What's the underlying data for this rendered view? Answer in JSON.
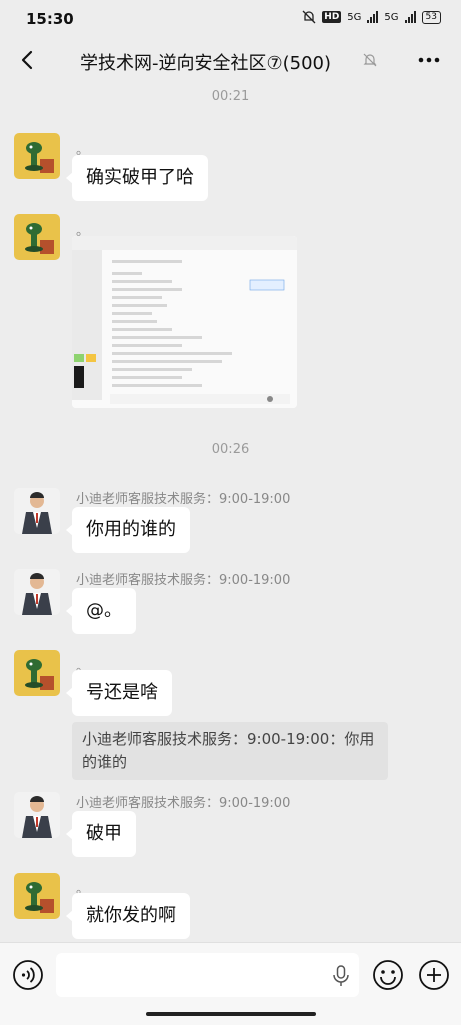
{
  "status_bar": {
    "time": "15:30",
    "hd_label": "HD",
    "net1": "5G",
    "net2": "5G",
    "battery": "53"
  },
  "nav": {
    "title": "学技术网-逆向安全社区⑦(500)"
  },
  "messages": {
    "ts1": "00:21",
    "m1_name": "。",
    "m1_text": "确实破甲了哈",
    "m2_name": "。",
    "ts2": "00:26",
    "m3_name": "小迪老师客服技术服务：9:00-19:00",
    "m3_text": "你用的谁的",
    "m4_name": "小迪老师客服技术服务：9:00-19:00",
    "m4_text": "@。",
    "m5_name": "。",
    "m5_text": "号还是啥",
    "m5_quote": "小迪老师客服技术服务：9:00-19:00：你用的谁的",
    "m6_name": "小迪老师客服技术服务：9:00-19:00",
    "m6_text": "破甲",
    "m7_name": "。",
    "m7_text": "就你发的啊"
  },
  "icons": {
    "back": "back-arrow-icon",
    "mute": "bell-off-icon",
    "more": "more-icon",
    "voice": "voice-icon",
    "mic": "microphone-icon",
    "emoji": "emoji-icon",
    "plus": "plus-icon"
  },
  "colors": {
    "background": "#ededed",
    "bubble": "#ffffff",
    "timestamp": "#9a9a9a"
  }
}
